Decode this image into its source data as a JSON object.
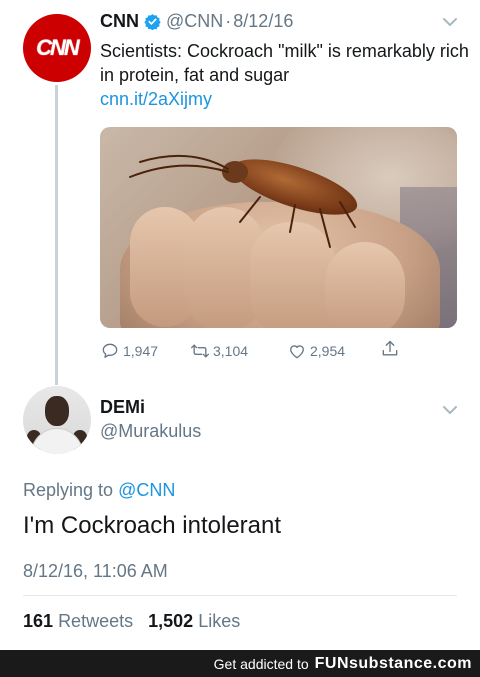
{
  "original_tweet": {
    "author_name": "CNN",
    "avatar_logo": "CNN",
    "verified": true,
    "handle": "@CNN",
    "separator": "·",
    "date": "8/12/16",
    "text": "Scientists: Cockroach \"milk\" is remarkably rich in protein, fat and sugar",
    "link": "cnn.it/2aXijmy",
    "media_description": "cockroach-on-fingers-photo",
    "reply_count": "1,947",
    "retweet_count": "3,104",
    "like_count": "2,954"
  },
  "reply_tweet": {
    "author_name": "DEMi",
    "handle": "@Murakulus",
    "replying_prefix": "Replying to",
    "replying_to": "@CNN",
    "text": "I'm Cockroach intolerant",
    "timestamp": "8/12/16, 11:06 AM",
    "retweets_count": "161",
    "retweets_label": "Retweets",
    "likes_count": "1,502",
    "likes_label": "Likes"
  },
  "footer": {
    "tagline": "Get addicted to",
    "brand": "FUNsubstance.com"
  },
  "colors": {
    "link_blue": "#1b95e0",
    "muted_gray": "#657786",
    "cnn_red": "#cc0000",
    "footer_bg": "#1a1a1a"
  }
}
